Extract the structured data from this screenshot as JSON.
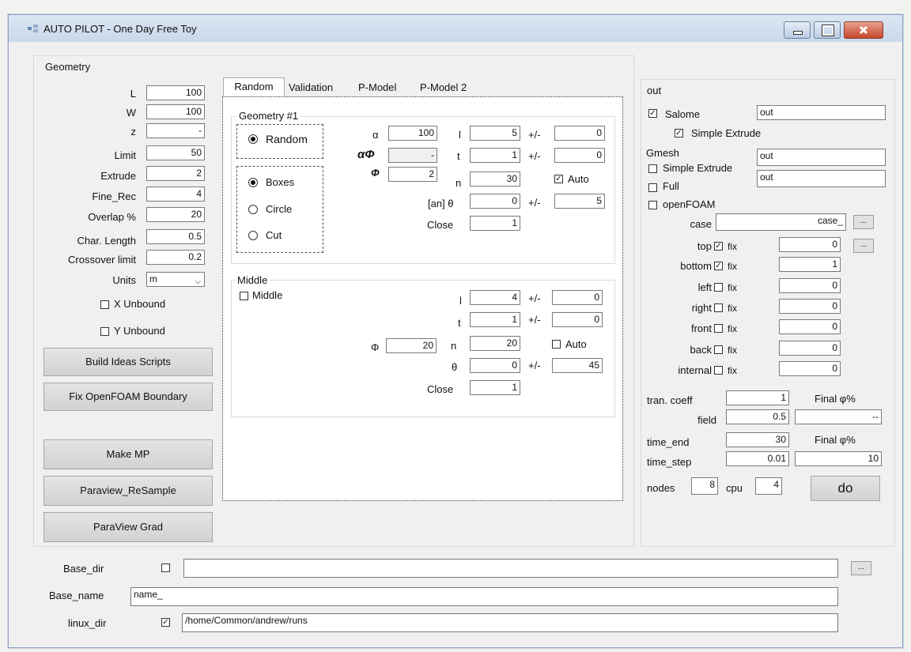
{
  "window": {
    "title": "AUTO PILOT - One Day Free Toy"
  },
  "geometry": {
    "header": "Geometry",
    "fields": [
      {
        "label": "L",
        "value": "100"
      },
      {
        "label": "W",
        "value": "100"
      },
      {
        "label": "z",
        "value": "-"
      },
      {
        "label": "Limit",
        "value": "50"
      },
      {
        "label": "Extrude",
        "value": "2"
      },
      {
        "label": "Fine_Rec",
        "value": "4"
      },
      {
        "label": "Overlap %",
        "value": "20"
      },
      {
        "label": "Char. Length",
        "value": "0.5"
      },
      {
        "label": "Crossover limit",
        "value": "0.2"
      }
    ],
    "units_label": "Units",
    "units_value": "m",
    "x_unbound": "X Unbound",
    "y_unbound": "Y Unbound"
  },
  "buttons": {
    "build": "Build Ideas Scripts",
    "fix": "Fix OpenFOAM Boundary",
    "make": "Make MP",
    "resample": "Paraview_ReSample",
    "grad": "ParaView Grad",
    "do": "do",
    "dots": "..."
  },
  "tabs": [
    "Random",
    "Validation",
    "P-Model",
    "P-Model 2"
  ],
  "geom1": {
    "header": "Geometry #1",
    "random": "Random",
    "boxes": "Boxes",
    "circle": "Circle",
    "cut": "Cut",
    "alpha_label": "α",
    "alpha_value": "100",
    "aphi_label": "αΦ",
    "aphi_value": "-",
    "phi_label": "Φ",
    "phi_value": "2",
    "l_label": "l",
    "l_value": "5",
    "l_pm": "+/-",
    "l_pm_value": "0",
    "t_label": "t",
    "t_value": "1",
    "t_pm": "+/-",
    "t_pm_value": "0",
    "n_label": "n",
    "n_value": "30",
    "auto": "Auto",
    "theta_label": "[an] θ",
    "theta_value": "0",
    "theta_pm": "+/-",
    "theta_pm_value": "5",
    "close_label": "Close",
    "close_value": "1"
  },
  "middle": {
    "header": "Middle",
    "check": "Middle",
    "phi_label": "Φ",
    "phi_value": "20",
    "l_label": "l",
    "l_value": "4",
    "l_pm": "+/-",
    "l_pm_value": "0",
    "t_label": "t",
    "t_value": "1",
    "t_pm": "+/-",
    "t_pm_value": "0",
    "n_label": "n",
    "n_value": "20",
    "auto": "Auto",
    "theta_label": "θ",
    "theta_value": "0",
    "theta_pm": "+/-",
    "theta_pm_value": "45",
    "close_label": "Close",
    "close_value": "1"
  },
  "out": {
    "header": "out",
    "salome": "Salome",
    "salome_value": "out",
    "simple_extrude": "Simple Extrude",
    "gmesh": "Gmesh",
    "gmesh_simple": "Simple Extrude",
    "gmesh_simple_value": "out",
    "full": "Full",
    "full_value": "out",
    "openfoam": "openFOAM",
    "case_label": "case",
    "case_value": "case_",
    "fix_label": "fix",
    "boundaries": [
      {
        "label": "top",
        "checked": true,
        "value": "0"
      },
      {
        "label": "bottom",
        "checked": true,
        "value": "1"
      },
      {
        "label": "left",
        "checked": false,
        "value": "0"
      },
      {
        "label": "right",
        "checked": false,
        "value": "0"
      },
      {
        "label": "front",
        "checked": false,
        "value": "0"
      },
      {
        "label": "back",
        "checked": false,
        "value": "0"
      },
      {
        "label": "internal",
        "checked": false,
        "value": "0"
      }
    ],
    "tran_coeff_label": "tran. coeff",
    "tran_coeff_value": "1",
    "final1_label": "Final φ%",
    "field_label": "field",
    "field_value": "0.5",
    "final1_value": "--",
    "time_end_label": "time_end",
    "time_end_value": "30",
    "final2_label": "Final φ%",
    "time_step_label": "time_step",
    "time_step_value": "0.01",
    "final2_value": "10",
    "nodes_label": "nodes",
    "nodes_value": "8",
    "cpu_label": "cpu",
    "cpu_value": "4"
  },
  "bottom": {
    "base_dir_label": "Base_dir",
    "base_dir_value": "",
    "base_name_label": "Base_name",
    "base_name_value": "name_",
    "linux_dir_label": "linux_dir",
    "linux_dir_value": "/home/Common/andrew/runs"
  }
}
